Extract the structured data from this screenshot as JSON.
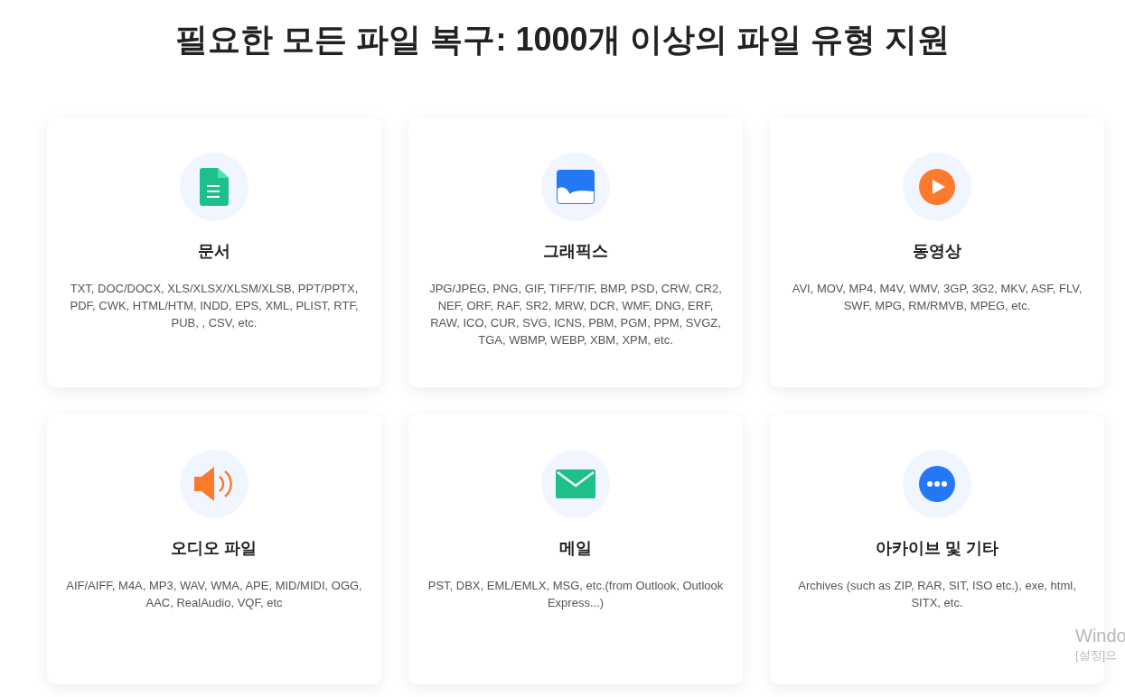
{
  "heading": "필요한 모든 파일 복구: 1000개 이상의 파일 유형 지원",
  "cards": [
    {
      "kind": "document",
      "title": "문서",
      "description": "TXT, DOC/DOCX, XLS/XLSX/XLSM/XLSB, PPT/PPTX, PDF, CWK, HTML/HTM, INDD, EPS, XML, PLIST, RTF, PUB, , CSV, etc."
    },
    {
      "kind": "graphics",
      "title": "그래픽스",
      "description": "JPG/JPEG, PNG, GIF, TIFF/TIF, BMP, PSD, CRW, CR2, NEF, ORF, RAF, SR2, MRW, DCR, WMF, DNG, ERF, RAW, ICO, CUR, SVG, ICNS, PBM, PGM, PPM, SVGZ, TGA, WBMP, WEBP, XBM, XPM, etc."
    },
    {
      "kind": "video",
      "title": "동영상",
      "description": "AVI, MOV, MP4, M4V, WMV, 3GP, 3G2, MKV, ASF, FLV, SWF, MPG, RM/RMVB, MPEG, etc."
    },
    {
      "kind": "audio",
      "title": "오디오 파일",
      "description": "AIF/AIFF, M4A, MP3, WAV, WMA, APE, MID/MIDI, OGG, AAC, RealAudio, VQF, etc"
    },
    {
      "kind": "email",
      "title": "메일",
      "description": "PST, DBX, EML/EMLX, MSG, etc.(from Outlook, Outlook Express...)"
    },
    {
      "kind": "other",
      "title": "아카이브 및 기타",
      "description": "Archives (such as ZIP, RAR, SIT, ISO etc.), exe, html, SITX, etc."
    }
  ],
  "os_watermark": [
    "Windo",
    "[설정]으"
  ]
}
